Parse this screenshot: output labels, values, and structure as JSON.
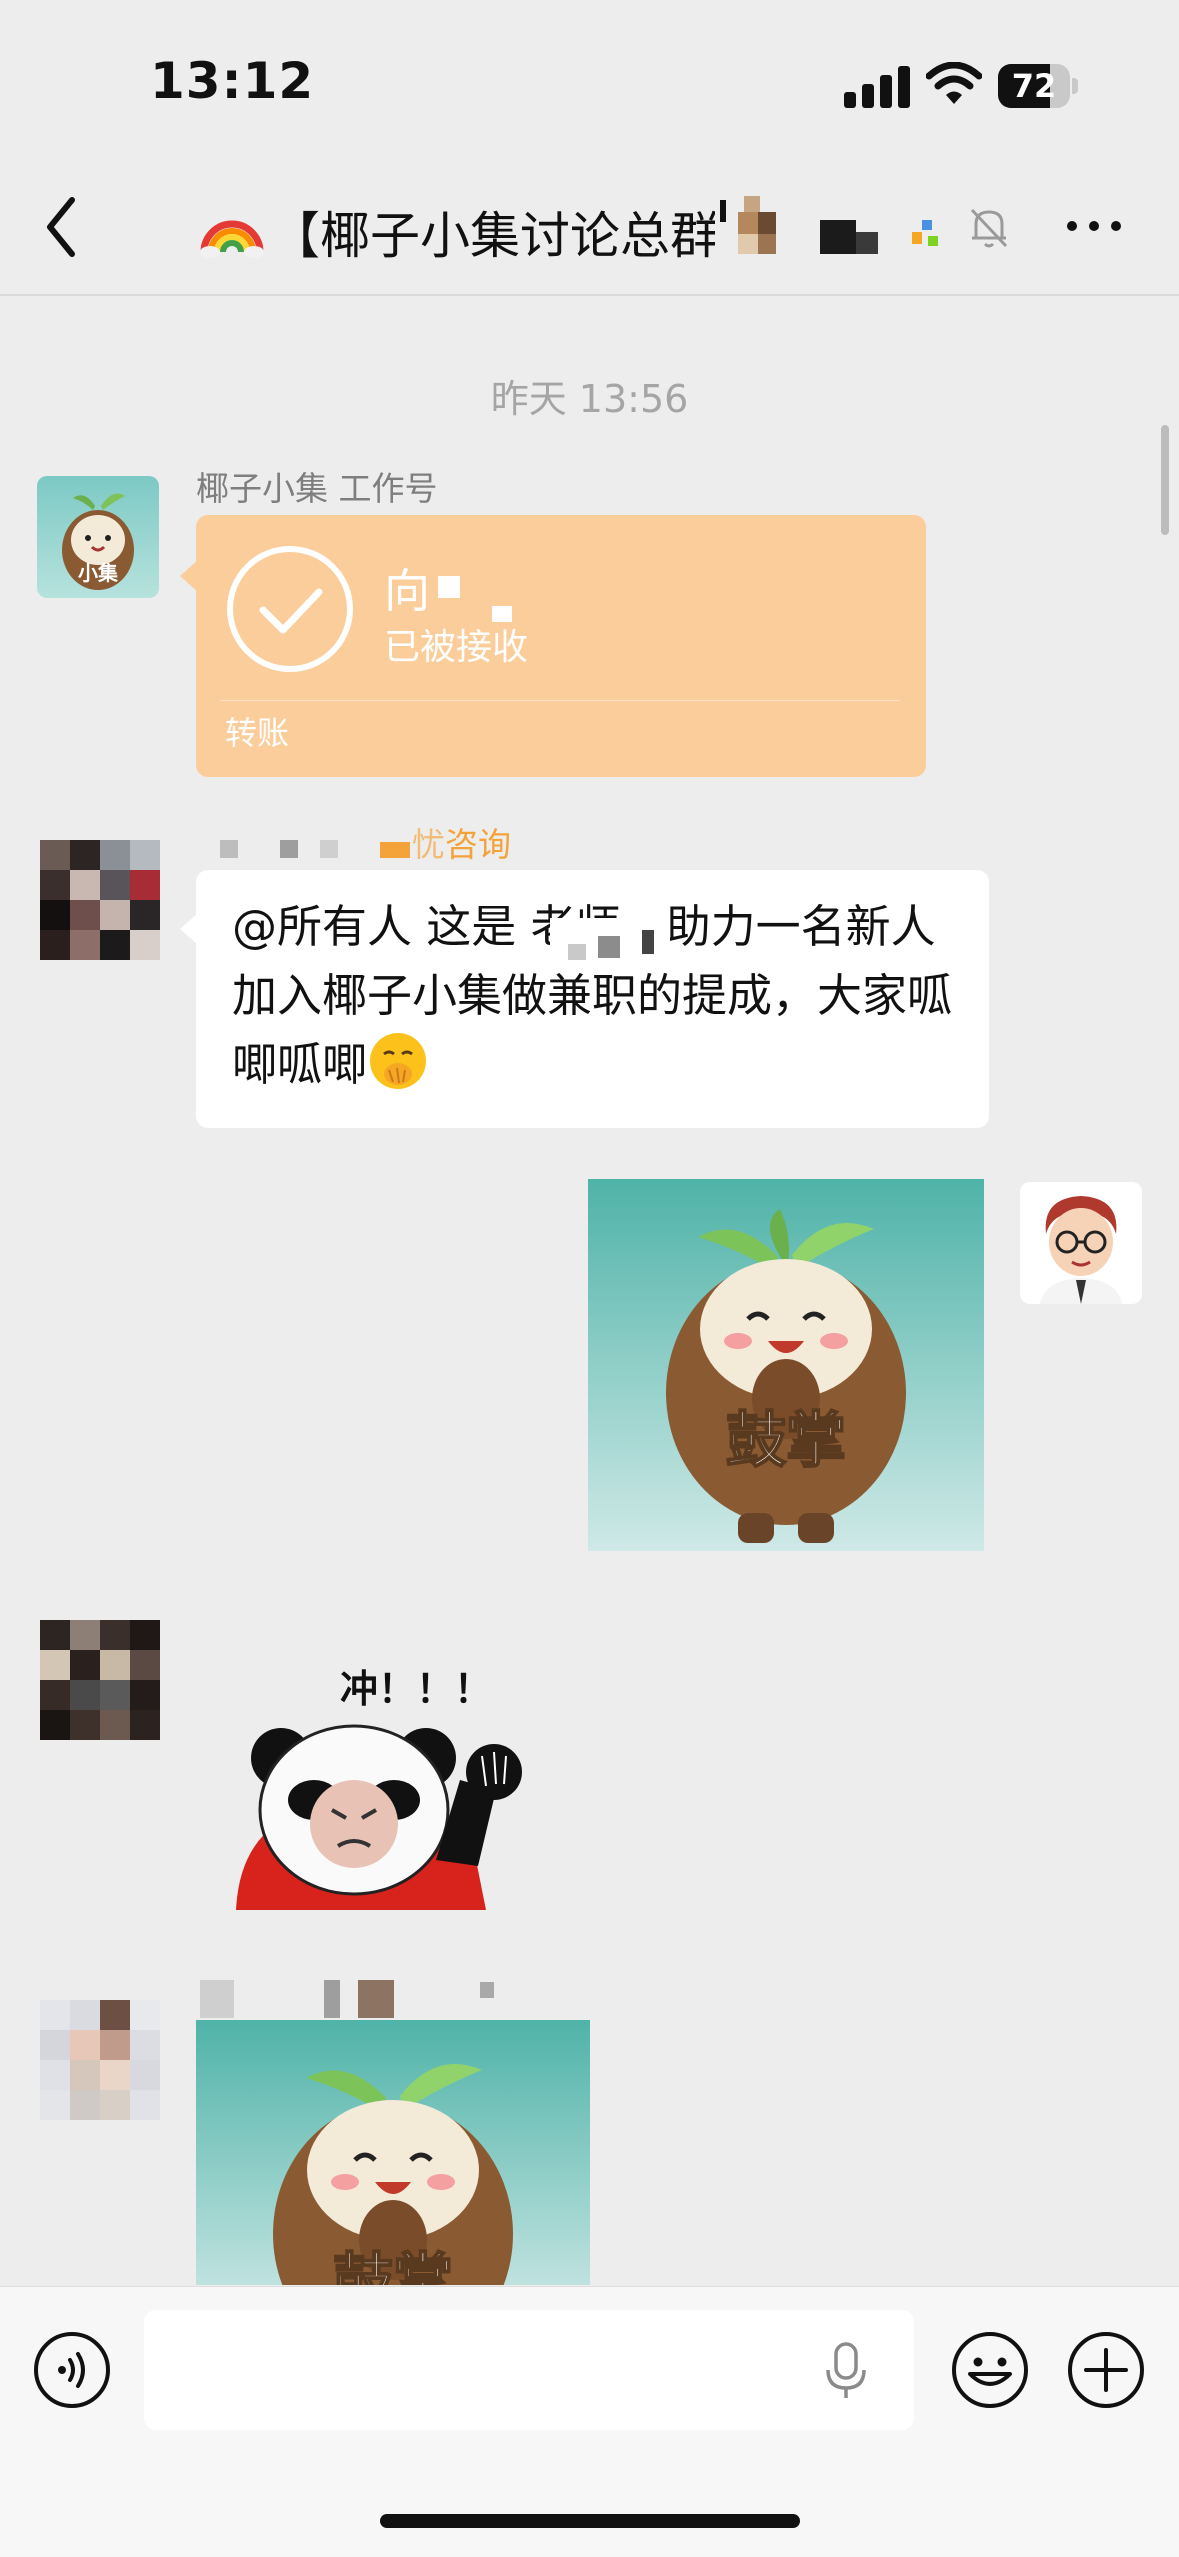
{
  "status": {
    "time": "13:12",
    "battery": "72",
    "battery_level": 0.72
  },
  "nav": {
    "title": "【椰子小集讨论总群",
    "title_emoji": "rainbow-icon"
  },
  "messages": {
    "timestamp": "昨天 13:56",
    "m1": {
      "sender": "椰子小集 工作号",
      "avatar_label": "小集",
      "transfer_title": "向 转账",
      "transfer_status": "已被接收",
      "transfer_label": "转账"
    },
    "m2": {
      "sender": "询",
      "text": "@所有人 这是 老师，助力一名新人加入椰子小集做兼职的提成，大家呱唧呱唧",
      "emoji": "shushing-face-icon"
    },
    "m3": {
      "sticker_caption": "鼓掌"
    },
    "m4": {
      "sticker_caption": "冲！！！"
    },
    "m5": {
      "sticker_caption": "鼓掌"
    }
  },
  "colors": {
    "transfer": "#fbcd9b",
    "background": "#ededed",
    "accent_orange": "#f4a33a"
  }
}
